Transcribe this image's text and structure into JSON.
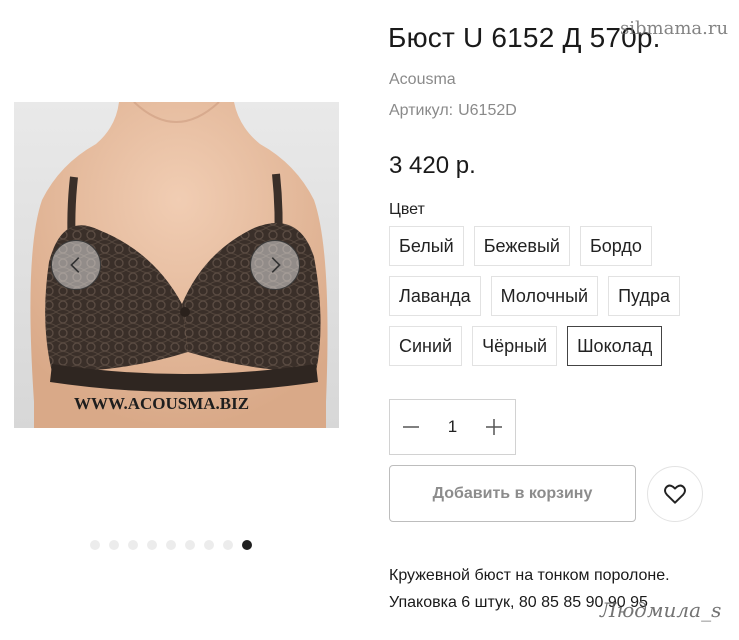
{
  "watermarks": {
    "top": "sibmama.ru",
    "bottom": "Людмила_s"
  },
  "product": {
    "title": "Бюст U 6152 Д 570р.",
    "brand": "Acousma",
    "sku_label": "Артикул:",
    "sku_value": "U6152D",
    "price": "3 420 р."
  },
  "gallery": {
    "image_watermark": "WWW.ACOUSMA.BIZ",
    "prev_icon": "chevron-left-icon",
    "next_icon": "chevron-right-icon",
    "slide_count": 9,
    "active_slide": 9
  },
  "colors": {
    "label": "Цвет",
    "rows": [
      [
        "Белый",
        "Бежевый",
        "Бордо"
      ],
      [
        "Лаванда",
        "Молочный",
        "Пудра"
      ],
      [
        "Синий",
        "Чёрный",
        "Шоколад"
      ]
    ],
    "selected": "Шоколад"
  },
  "quantity": {
    "value": "1",
    "minus_icon": "minus-icon",
    "plus_icon": "plus-icon"
  },
  "cart": {
    "add_label": "Добавить в корзину",
    "wishlist_icon": "heart-icon"
  },
  "description": {
    "line1": "Кружевной бюст на тонком поролоне.",
    "line2": "Упаковка 6 штук, 80 85 85 90 90 95"
  },
  "theme": {
    "text": "#222222",
    "muted": "#8a8a8a",
    "border": "#e2e2e2",
    "selected_border": "#444444",
    "lace": "#3a2f29",
    "skin": "#e8bfa2"
  }
}
